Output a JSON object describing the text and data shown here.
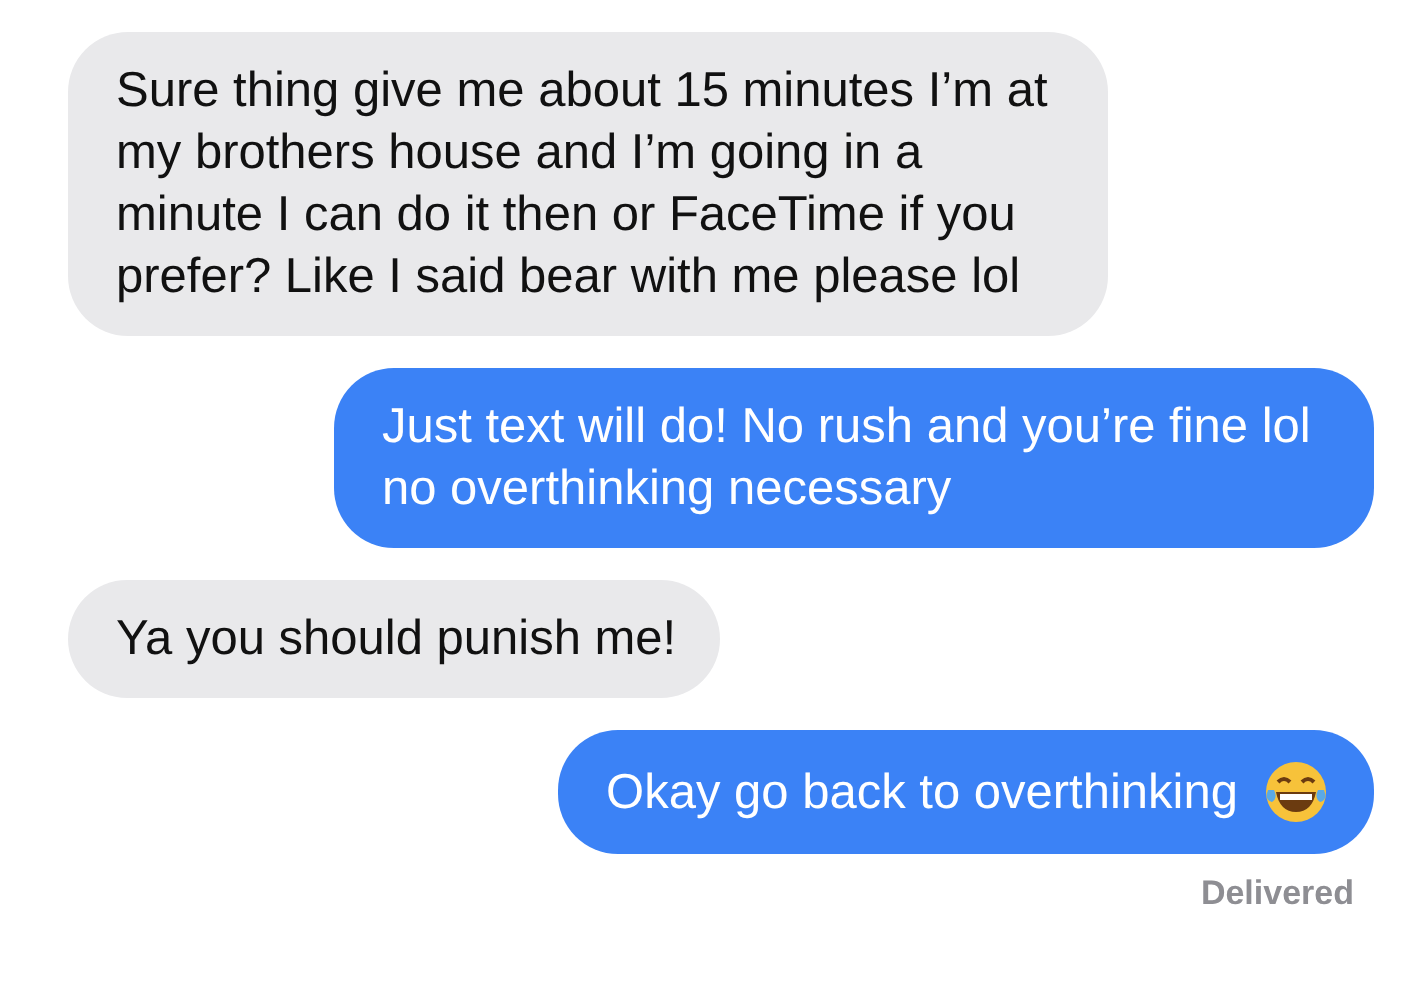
{
  "messages": [
    {
      "kind": "received",
      "text": "Sure thing give me about 15 minutes I’m at my brothers house and I’m going in a minute I can do it then or FaceTime if you prefer? Like I said bear with me please lol",
      "emoji": false
    },
    {
      "kind": "sent",
      "text": "Just text will do! No rush and you’re fine lol no overthinking necessary",
      "emoji": false
    },
    {
      "kind": "received",
      "text": "Ya you should punish me!",
      "emoji": false
    },
    {
      "kind": "sent",
      "text": "Okay go back to overthinking",
      "emoji": true
    }
  ],
  "status": "Delivered"
}
